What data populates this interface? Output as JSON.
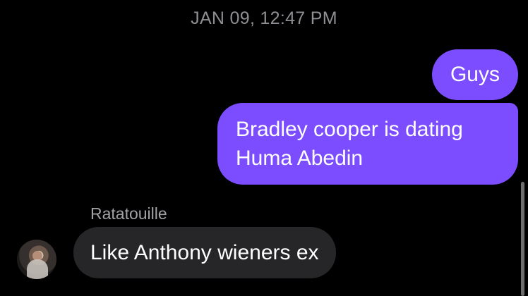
{
  "thread": {
    "timestamp": "JAN 09, 12:47 PM"
  },
  "messages": [
    {
      "direction": "sent",
      "text": "Guys"
    },
    {
      "direction": "sent",
      "text": "Bradley cooper is dating Huma Abedin"
    },
    {
      "direction": "received",
      "sender": "Ratatouille",
      "text": "Like Anthony wieners ex"
    }
  ],
  "colors": {
    "background": "#000000",
    "sent_bubble": "#7b4dff",
    "received_bubble": "#262628",
    "timestamp_text": "#8e8e93"
  },
  "icons": {
    "avatar": "avatar-photo"
  }
}
